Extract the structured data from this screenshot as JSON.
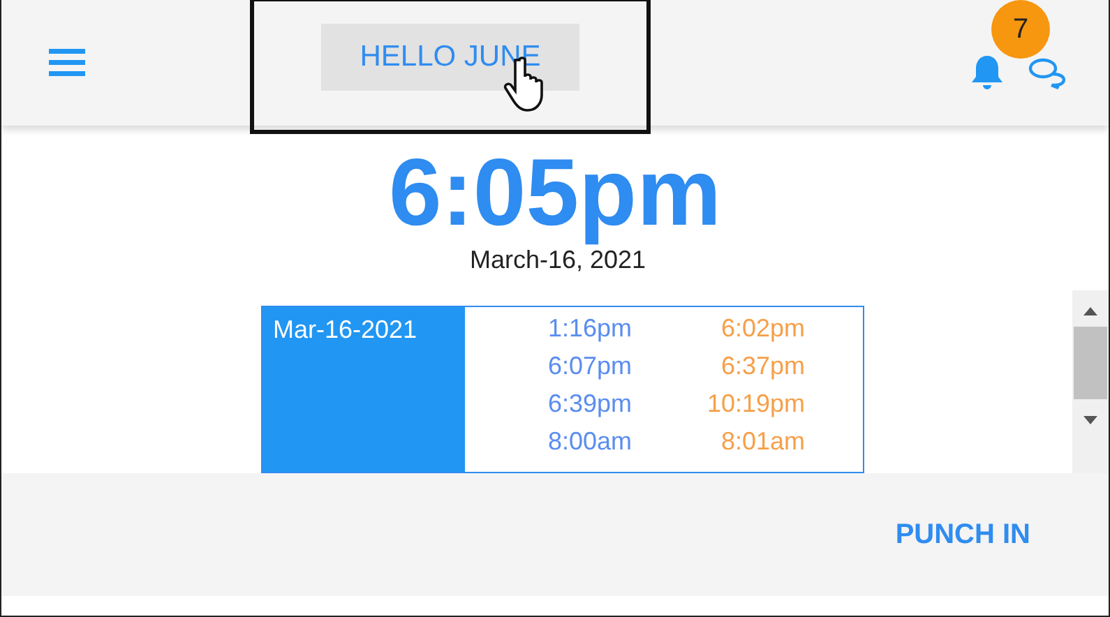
{
  "header": {
    "greeting": "HELLO JUNE",
    "notifications": {
      "count": "7"
    }
  },
  "clock": {
    "time": "6:05pm",
    "date": "March-16, 2021"
  },
  "punch_log": {
    "day": "Mar-16-2021",
    "entries": [
      {
        "in": "1:16pm",
        "out": "6:02pm"
      },
      {
        "in": "6:07pm",
        "out": "6:37pm"
      },
      {
        "in": "6:39pm",
        "out": "10:19pm"
      },
      {
        "in": "8:00am",
        "out": "8:01am"
      }
    ]
  },
  "footer": {
    "action": "PUNCH IN"
  }
}
